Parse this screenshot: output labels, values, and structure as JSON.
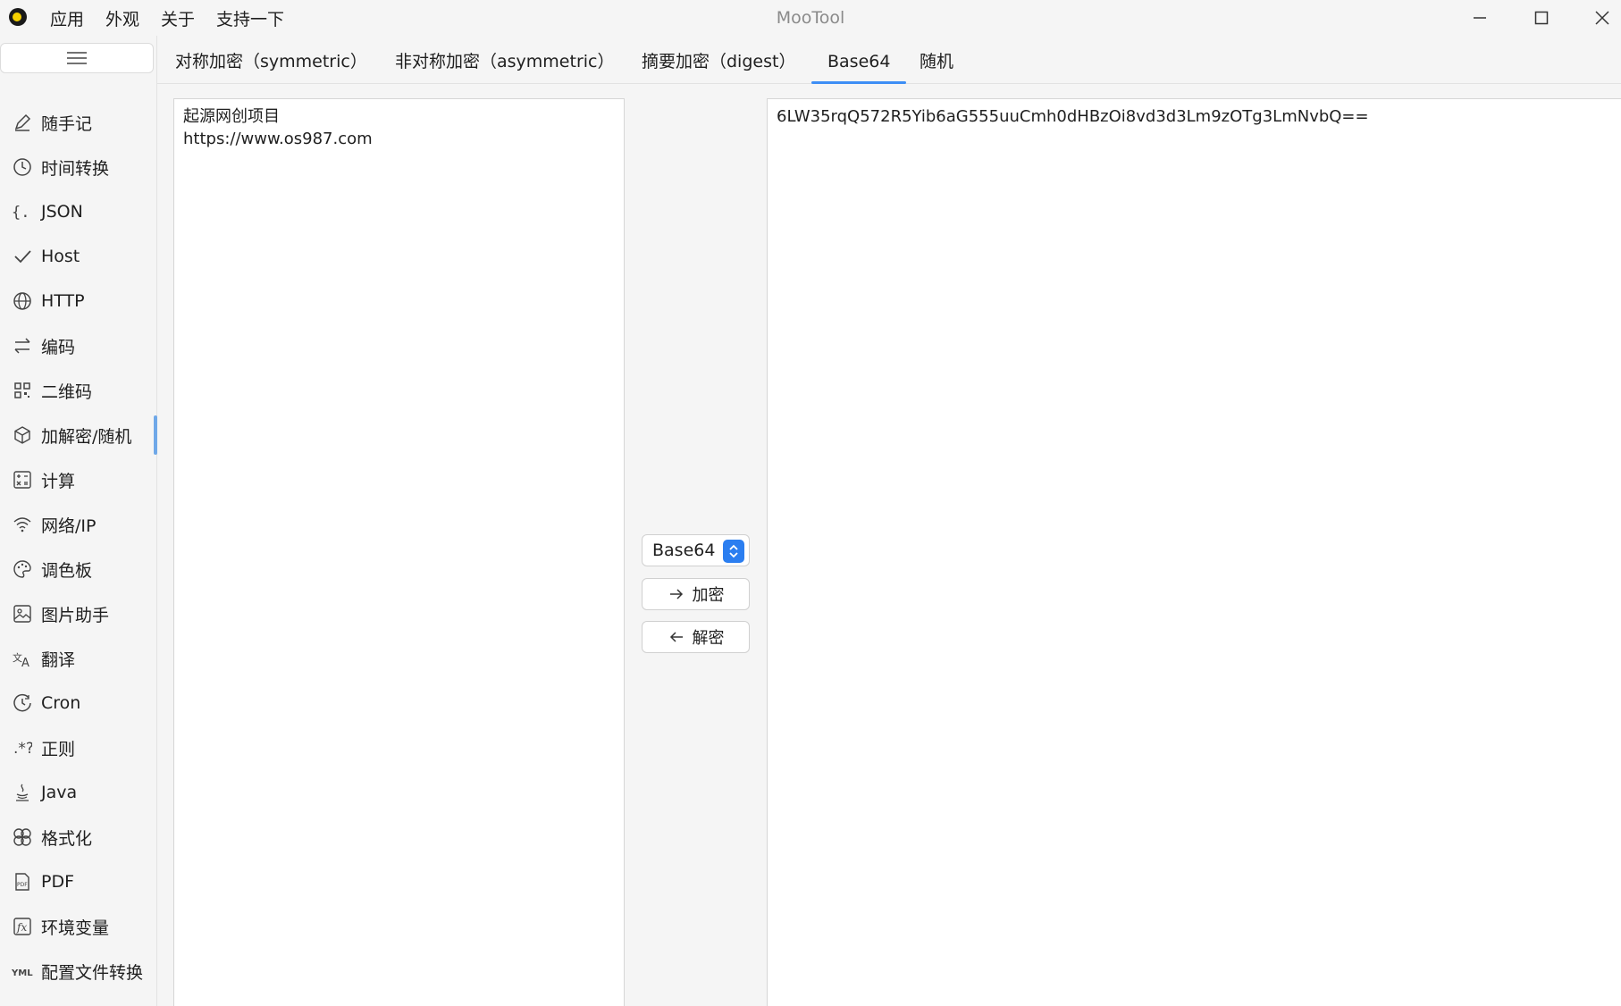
{
  "window": {
    "title": "MooTool",
    "menu": [
      "应用",
      "外观",
      "关于",
      "支持一下"
    ]
  },
  "sidebar": {
    "items": [
      {
        "label": "随手记",
        "icon": "pencil-icon"
      },
      {
        "label": "时间转换",
        "icon": "clock-icon"
      },
      {
        "label": "JSON",
        "icon": "braces-icon"
      },
      {
        "label": "Host",
        "icon": "check-icon"
      },
      {
        "label": "HTTP",
        "icon": "globe-icon"
      },
      {
        "label": "编码",
        "icon": "swap-arrows-icon"
      },
      {
        "label": "二维码",
        "icon": "qrcode-icon"
      },
      {
        "label": "加解密/随机",
        "icon": "cube-icon",
        "active": true
      },
      {
        "label": "计算",
        "icon": "calculator-icon"
      },
      {
        "label": "网络/IP",
        "icon": "wifi-icon"
      },
      {
        "label": "调色板",
        "icon": "palette-icon"
      },
      {
        "label": "图片助手",
        "icon": "image-icon"
      },
      {
        "label": "翻译",
        "icon": "translate-icon"
      },
      {
        "label": "Cron",
        "icon": "cron-clock-icon"
      },
      {
        "label": "正则",
        "icon": "regex-icon"
      },
      {
        "label": "Java",
        "icon": "java-icon"
      },
      {
        "label": "格式化",
        "icon": "format-icon"
      },
      {
        "label": "PDF",
        "icon": "pdf-icon"
      },
      {
        "label": "环境变量",
        "icon": "function-icon"
      },
      {
        "label": "配置文件转换",
        "icon": "yaml-icon"
      }
    ]
  },
  "tabs": [
    {
      "label": "对称加密（symmetric）"
    },
    {
      "label": "非对称加密（asymmetric）"
    },
    {
      "label": "摘要加密（digest）"
    },
    {
      "label": "Base64",
      "active": true
    },
    {
      "label": "随机"
    }
  ],
  "base64": {
    "input_text": "起源网创项目\nhttps://www.os987.com",
    "output_text": "6LW35rqQ572R5Yib6aG555uuCmh0dHBzOi8vd3d3Lm9zOTg3LmNvbQ==",
    "mode_select": "Base64",
    "encrypt_label": "加密",
    "decrypt_label": "解密"
  },
  "colors": {
    "accent": "#3d8ef5",
    "sidebar_active_indicator": "#6fa8e8",
    "select_arrow_bg": "#2b7ef0"
  }
}
